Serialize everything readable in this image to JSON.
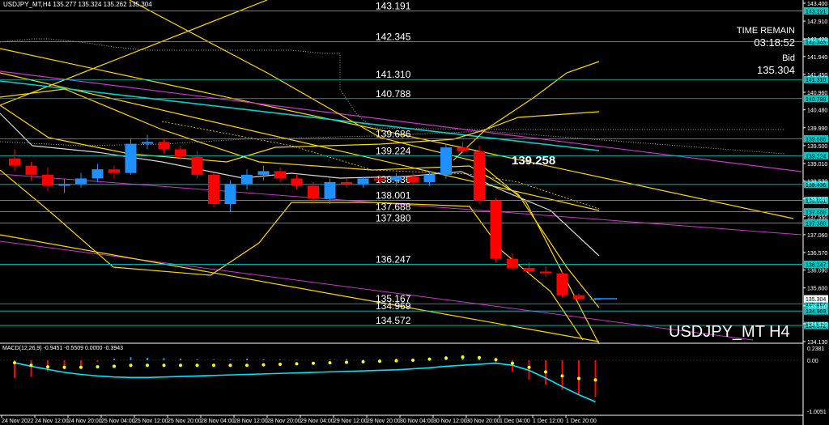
{
  "header": {
    "symbol_info": "USDJPY_MT,H4  135.277 135.324 135.262 135.304"
  },
  "info_panel": {
    "time_label": "TIME REMAIN",
    "time_value": "03:18:52",
    "bid_label": "Bid",
    "bid_value": "135.304"
  },
  "watermark": "USDJPY_MT H4",
  "callout_price": "139.258",
  "colors": {
    "background": "#000000",
    "bull": "#1e90ff",
    "bear": "#ff0000",
    "level_line": "#00c8c8",
    "trend_yellow": "#ffd700",
    "trend_magenta": "#cc33cc",
    "ma_white": "#d8d8d8",
    "ma_cyan": "#00d0d0",
    "macd_signal": "#00e5ff",
    "macd_dots": "#ffff00"
  },
  "chart_data": {
    "type": "candlestick",
    "y_axis_ticks": [
      "143.400",
      "142.910",
      "142.420",
      "141.940",
      "141.450",
      "140.960",
      "140.480",
      "139.990",
      "139.500",
      "139.010",
      "138.530",
      "138.040",
      "137.550",
      "137.060",
      "136.570",
      "136.090",
      "135.600",
      "135.110",
      "134.620",
      "134.130"
    ],
    "price_range": [
      134.13,
      143.4
    ],
    "x_axis_labels": [
      "24 Nov 2022",
      "24 Nov 12:00",
      "24 Nov 20:00",
      "25 Nov 04:00",
      "25 Nov 12:00",
      "25 Nov 20:00",
      "28 Nov 04:00",
      "28 Nov 12:00",
      "28 Nov 20:00",
      "29 Nov 04:00",
      "29 Nov 12:00",
      "29 Nov 20:00",
      "30 Nov 04:00",
      "30 Nov 12:00",
      "30 Nov 20:00",
      "1 Dec 04:00",
      "1 Dec 12:00",
      "1 Dec 20:00"
    ],
    "levels": [
      {
        "label": "143.191",
        "price": 143.191,
        "tag": "143.191"
      },
      {
        "label": "142.345",
        "price": 142.345,
        "tag": "142.345"
      },
      {
        "label": "141.310",
        "price": 141.31,
        "tag": "141.310"
      },
      {
        "label": "140.788",
        "price": 140.788,
        "tag": "140.788"
      },
      {
        "label": "139.686",
        "price": 139.686,
        "tag": "139.686"
      },
      {
        "label": "139.224",
        "price": 139.224,
        "tag": "139.224"
      },
      {
        "label": "138.436",
        "price": 138.436,
        "tag": "138.436"
      },
      {
        "label": "138.001",
        "price": 138.001,
        "tag": "138.001"
      },
      {
        "label": "137.688",
        "price": 137.688,
        "tag": "137.688"
      },
      {
        "label": "137.380",
        "price": 137.38,
        "tag": "137.380"
      },
      {
        "label": "136.247",
        "price": 136.247,
        "tag": "136.247"
      },
      {
        "label": "135.167",
        "price": 135.167,
        "tag": "135.167"
      },
      {
        "label": "134.969",
        "price": 134.969,
        "tag": "134.969"
      },
      {
        "label": "134.572",
        "price": 134.572,
        "tag": "134.572"
      }
    ],
    "current_price": {
      "label": "135.304",
      "price": 135.304
    },
    "candles": [
      {
        "o": 139.15,
        "h": 139.4,
        "l": 138.8,
        "c": 138.95
      },
      {
        "o": 138.95,
        "h": 139.05,
        "l": 138.55,
        "c": 138.7
      },
      {
        "o": 138.7,
        "h": 138.9,
        "l": 138.25,
        "c": 138.4
      },
      {
        "o": 138.4,
        "h": 138.6,
        "l": 138.2,
        "c": 138.45
      },
      {
        "o": 138.45,
        "h": 138.75,
        "l": 138.35,
        "c": 138.6
      },
      {
        "o": 138.6,
        "h": 139.0,
        "l": 138.5,
        "c": 138.85
      },
      {
        "o": 138.85,
        "h": 138.95,
        "l": 138.6,
        "c": 138.75
      },
      {
        "o": 138.75,
        "h": 139.7,
        "l": 138.7,
        "c": 139.55
      },
      {
        "o": 139.55,
        "h": 139.8,
        "l": 139.4,
        "c": 139.6
      },
      {
        "o": 139.6,
        "h": 139.7,
        "l": 139.3,
        "c": 139.4
      },
      {
        "o": 139.4,
        "h": 139.5,
        "l": 139.1,
        "c": 139.2
      },
      {
        "o": 139.2,
        "h": 139.35,
        "l": 138.6,
        "c": 138.7
      },
      {
        "o": 138.7,
        "h": 138.75,
        "l": 137.8,
        "c": 137.9
      },
      {
        "o": 137.9,
        "h": 138.55,
        "l": 137.7,
        "c": 138.45
      },
      {
        "o": 138.45,
        "h": 138.85,
        "l": 138.3,
        "c": 138.7
      },
      {
        "o": 138.7,
        "h": 138.95,
        "l": 138.55,
        "c": 138.8
      },
      {
        "o": 138.8,
        "h": 138.9,
        "l": 138.5,
        "c": 138.6
      },
      {
        "o": 138.6,
        "h": 138.7,
        "l": 138.3,
        "c": 138.4
      },
      {
        "o": 138.4,
        "h": 138.5,
        "l": 137.95,
        "c": 138.05
      },
      {
        "o": 138.05,
        "h": 138.6,
        "l": 137.9,
        "c": 138.5
      },
      {
        "o": 138.5,
        "h": 138.6,
        "l": 138.35,
        "c": 138.45
      },
      {
        "o": 138.45,
        "h": 138.65,
        "l": 138.35,
        "c": 138.6
      },
      {
        "o": 138.6,
        "h": 138.7,
        "l": 138.45,
        "c": 138.55
      },
      {
        "o": 138.55,
        "h": 138.75,
        "l": 138.4,
        "c": 138.65
      },
      {
        "o": 138.65,
        "h": 138.75,
        "l": 138.4,
        "c": 138.5
      },
      {
        "o": 138.5,
        "h": 138.8,
        "l": 138.4,
        "c": 138.7
      },
      {
        "o": 138.7,
        "h": 139.55,
        "l": 138.6,
        "c": 139.45
      },
      {
        "o": 139.45,
        "h": 139.6,
        "l": 139.3,
        "c": 139.35
      },
      {
        "o": 139.35,
        "h": 139.5,
        "l": 137.9,
        "c": 138.0
      },
      {
        "o": 138.0,
        "h": 138.05,
        "l": 136.3,
        "c": 136.4
      },
      {
        "o": 136.4,
        "h": 136.55,
        "l": 136.1,
        "c": 136.15
      },
      {
        "o": 136.15,
        "h": 136.3,
        "l": 135.95,
        "c": 136.05
      },
      {
        "o": 136.05,
        "h": 136.2,
        "l": 135.9,
        "c": 136.0
      },
      {
        "o": 136.0,
        "h": 136.05,
        "l": 135.35,
        "c": 135.4
      },
      {
        "o": 135.4,
        "h": 135.45,
        "l": 135.25,
        "c": 135.3
      },
      {
        "o": 135.28,
        "h": 135.32,
        "l": 135.26,
        "c": 135.3
      }
    ],
    "macd": {
      "label": "MACD(12,26,9) -0.9451 -0.5509 0.0000 -0.3943",
      "axis_ticks": [
        "0.2381",
        "0.00",
        "-1.0051"
      ],
      "range": [
        -1.0051,
        0.2381
      ],
      "histogram": [
        -0.35,
        -0.32,
        -0.22,
        -0.18,
        -0.12,
        -0.03,
        0.03,
        0.06,
        0.05,
        0.04,
        0.03,
        0.02,
        0.01,
        0.02,
        0.03,
        0.02,
        0.01,
        0.01,
        0.0,
        0.01,
        0.02,
        0.01,
        0.02,
        0.03,
        0.02,
        0.03,
        0.08,
        0.1,
        0.06,
        -0.05,
        -0.22,
        -0.38,
        -0.48,
        -0.58,
        -0.68,
        -0.72
      ],
      "signal": [
        -0.05,
        -0.12,
        -0.18,
        -0.24,
        -0.28,
        -0.31,
        -0.33,
        -0.34,
        -0.34,
        -0.33,
        -0.32,
        -0.31,
        -0.3,
        -0.29,
        -0.28,
        -0.27,
        -0.26,
        -0.25,
        -0.24,
        -0.23,
        -0.22,
        -0.21,
        -0.2,
        -0.19,
        -0.17,
        -0.15,
        -0.12,
        -0.1,
        -0.08,
        -0.06,
        -0.1,
        -0.2,
        -0.35,
        -0.52,
        -0.68,
        -0.82
      ],
      "dots": [
        -0.05,
        -0.1,
        -0.13,
        -0.14,
        -0.14,
        -0.13,
        -0.12,
        -0.1,
        -0.1,
        -0.1,
        -0.1,
        -0.1,
        -0.1,
        -0.1,
        -0.1,
        -0.09,
        -0.08,
        -0.07,
        -0.06,
        -0.05,
        -0.04,
        -0.03,
        -0.02,
        -0.01,
        0.0,
        0.02,
        0.04,
        0.06,
        0.05,
        0.01,
        -0.06,
        -0.14,
        -0.23,
        -0.31,
        -0.36,
        -0.39
      ]
    }
  }
}
